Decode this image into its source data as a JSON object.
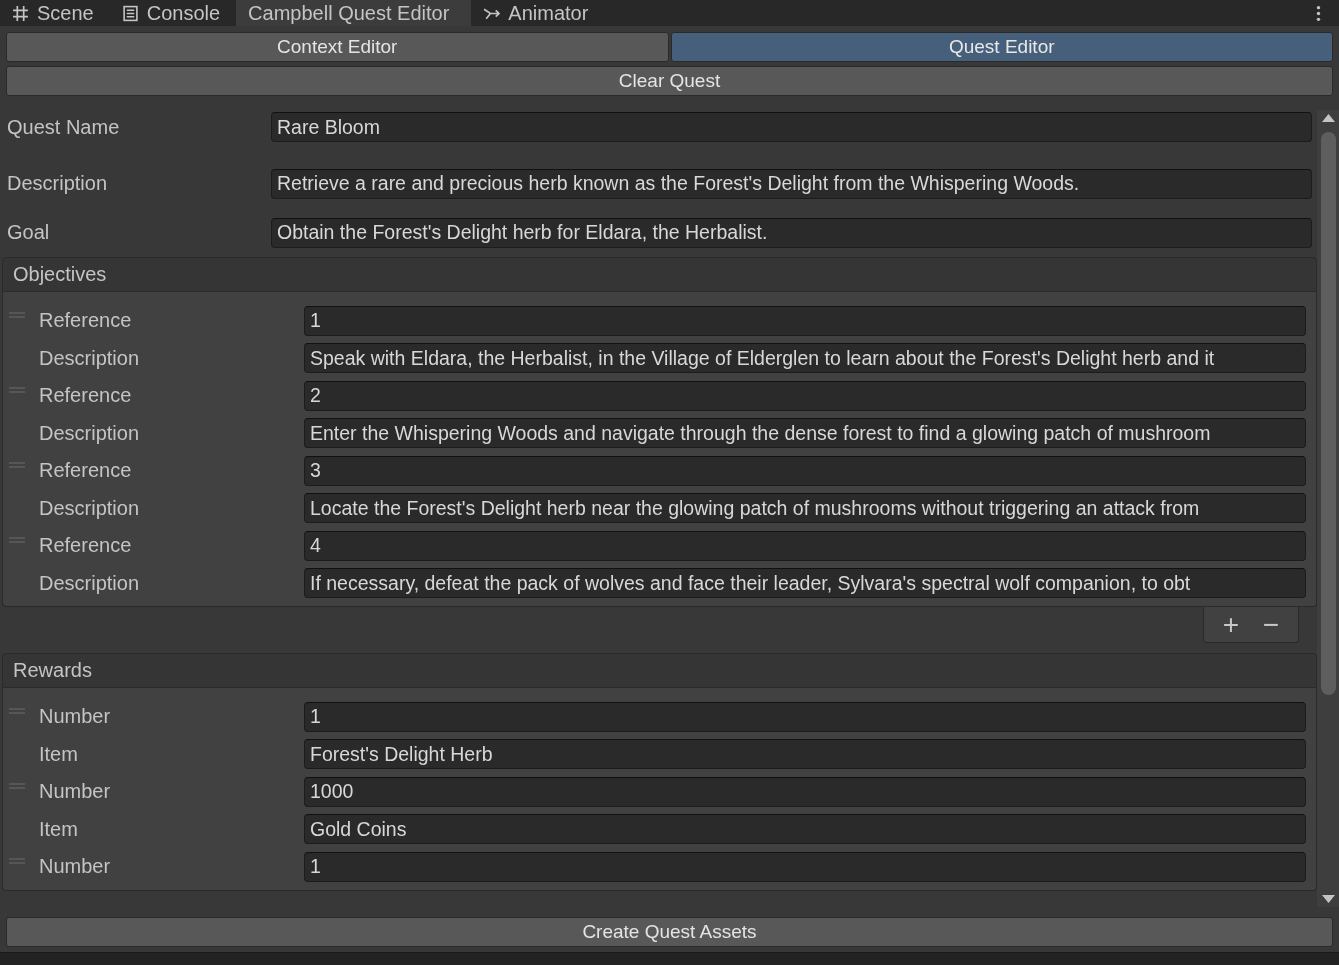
{
  "tabs": [
    {
      "label": "Scene",
      "kind": "grid",
      "selected": false
    },
    {
      "label": "Console",
      "kind": "console",
      "selected": false
    },
    {
      "label": "Campbell Quest Editor",
      "kind": "plain",
      "selected": true
    },
    {
      "label": "Animator",
      "kind": "animator",
      "selected": false
    }
  ],
  "mode_buttons": [
    {
      "label": "Context Editor",
      "selected": false
    },
    {
      "label": "Quest Editor",
      "selected": true
    }
  ],
  "clear_button": "Clear Quest",
  "fields": [
    {
      "label": "Quest Name",
      "value": "Rare Bloom"
    },
    {
      "label": "Description",
      "value": "Retrieve a rare and precious herb known as the Forest's Delight from the Whispering Woods."
    },
    {
      "label": "Goal",
      "value": "Obtain the Forest's Delight herb for Eldara, the Herbalist."
    }
  ],
  "objectives": {
    "title": "Objectives",
    "items": [
      {
        "fields": [
          {
            "label": "Reference",
            "value": "1"
          },
          {
            "label": "Description",
            "value": "Speak with Eldara, the Herbalist, in the Village of Elderglen to learn about the Forest's Delight herb and it"
          }
        ]
      },
      {
        "fields": [
          {
            "label": "Reference",
            "value": "2"
          },
          {
            "label": "Description",
            "value": "Enter the Whispering Woods and navigate through the dense forest to find a glowing patch of mushroom"
          }
        ]
      },
      {
        "fields": [
          {
            "label": "Reference",
            "value": "3"
          },
          {
            "label": "Description",
            "value": "Locate the Forest's Delight herb near the glowing patch of mushrooms without triggering an attack from"
          }
        ]
      },
      {
        "fields": [
          {
            "label": "Reference",
            "value": "4"
          },
          {
            "label": "Description",
            "value": "If necessary, defeat the pack of wolves and face their leader, Sylvara's spectral wolf companion, to obt"
          }
        ]
      }
    ],
    "add_button": "+",
    "remove_button": "−"
  },
  "rewards": {
    "title": "Rewards",
    "items": [
      {
        "fields": [
          {
            "label": "Number",
            "value": "1"
          },
          {
            "label": "Item",
            "value": "Forest's Delight Herb"
          }
        ]
      },
      {
        "fields": [
          {
            "label": "Number",
            "value": "1000"
          },
          {
            "label": "Item",
            "value": "Gold Coins"
          }
        ]
      },
      {
        "fields": [
          {
            "label": "Number",
            "value": "1"
          }
        ]
      }
    ]
  },
  "create_button": "Create Quest Assets"
}
